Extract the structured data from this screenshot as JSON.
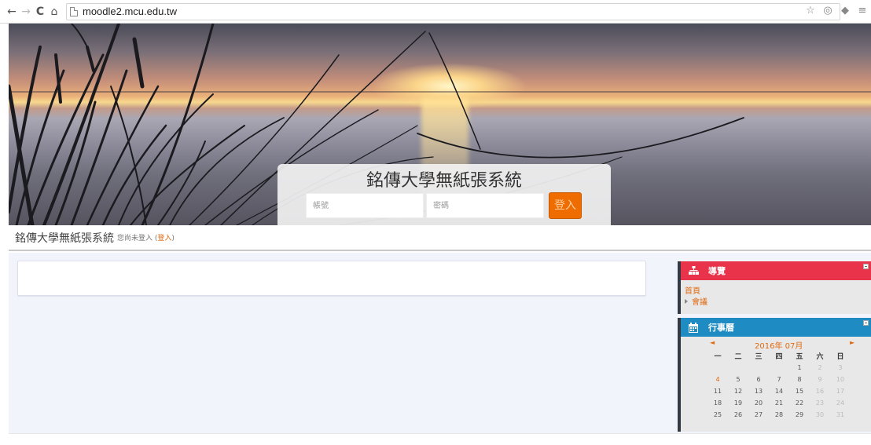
{
  "browser": {
    "url": "moodle2.mcu.edu.tw",
    "back_glyph": "←",
    "forward_glyph": "→",
    "reload_glyph": "C",
    "home_glyph": "⌂",
    "star_glyph": "☆",
    "ext1_glyph": "◎",
    "ext2_glyph": "◆",
    "menu_glyph": "≡"
  },
  "banner": {
    "title": "銘傳大學無紙張系統",
    "username_placeholder": "帳號",
    "password_placeholder": "密碼",
    "login_button": "登入"
  },
  "header": {
    "site_name": "銘傳大學無紙張系統",
    "login_status": "您尚未登入 (",
    "login_link": "登入",
    "login_close": ")"
  },
  "blocks": {
    "navigation": {
      "title": "導覽",
      "items": [
        "首頁",
        "會議"
      ]
    },
    "calendar": {
      "title": "行事曆",
      "month": "2016年 07月",
      "prev": "◄",
      "next": "►",
      "weekdays": [
        "一",
        "二",
        "三",
        "四",
        "五",
        "六",
        "日"
      ],
      "weeks": [
        [
          "",
          "",
          "",
          "",
          "1",
          "2",
          "3"
        ],
        [
          "4",
          "5",
          "6",
          "7",
          "8",
          "9",
          "10"
        ],
        [
          "11",
          "12",
          "13",
          "14",
          "15",
          "16",
          "17"
        ],
        [
          "18",
          "19",
          "20",
          "21",
          "22",
          "23",
          "24"
        ],
        [
          "25",
          "26",
          "27",
          "28",
          "29",
          "30",
          "31"
        ]
      ]
    }
  },
  "colors": {
    "navigation_header": "#e8334a",
    "calendar_header": "#1e8bc3",
    "accent": "#ef6c00"
  }
}
